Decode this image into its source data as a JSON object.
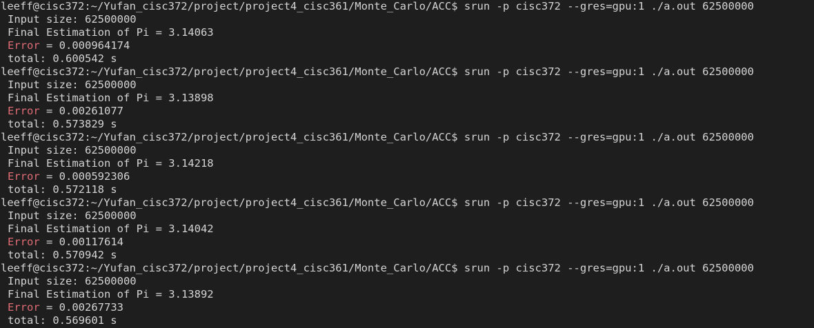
{
  "terminal": {
    "runs": [
      {
        "prompt": "leeff@cisc372:~/Yufan_cisc372/project/project4_cisc361/Monte_Carlo/ACC$ srun -p cisc372 --gres=gpu:1 ./a.out 62500000",
        "input_size": "Input size: 62500000",
        "estimation": "Final Estimation of Pi = 3.14063",
        "error_label": "Error",
        "error_value": " = 0.000964174",
        "total": "total: 0.600542 s"
      },
      {
        "prompt": "leeff@cisc372:~/Yufan_cisc372/project/project4_cisc361/Monte_Carlo/ACC$ srun -p cisc372 --gres=gpu:1 ./a.out 62500000",
        "input_size": "Input size: 62500000",
        "estimation": "Final Estimation of Pi = 3.13898",
        "error_label": "Error",
        "error_value": " = 0.00261077",
        "total": "total: 0.573829 s"
      },
      {
        "prompt": "leeff@cisc372:~/Yufan_cisc372/project/project4_cisc361/Monte_Carlo/ACC$ srun -p cisc372 --gres=gpu:1 ./a.out 62500000",
        "input_size": "Input size: 62500000",
        "estimation": "Final Estimation of Pi = 3.14218",
        "error_label": "Error",
        "error_value": " = 0.000592306",
        "total": "total: 0.572118 s"
      },
      {
        "prompt": "leeff@cisc372:~/Yufan_cisc372/project/project4_cisc361/Monte_Carlo/ACC$ srun -p cisc372 --gres=gpu:1 ./a.out 62500000",
        "input_size": "Input size: 62500000",
        "estimation": "Final Estimation of Pi = 3.14042",
        "error_label": "Error",
        "error_value": " = 0.00117614",
        "total": "total: 0.570942 s"
      },
      {
        "prompt": "leeff@cisc372:~/Yufan_cisc372/project/project4_cisc361/Monte_Carlo/ACC$ srun -p cisc372 --gres=gpu:1 ./a.out 62500000",
        "input_size": "Input size: 62500000",
        "estimation": "Final Estimation of Pi = 3.13892",
        "error_label": "Error",
        "error_value": " = 0.00267733",
        "total": "total: 0.569601 s"
      }
    ]
  },
  "colors": {
    "background": "#1e1e1e",
    "text": "#d4d4d4",
    "error": "#e06c75"
  }
}
